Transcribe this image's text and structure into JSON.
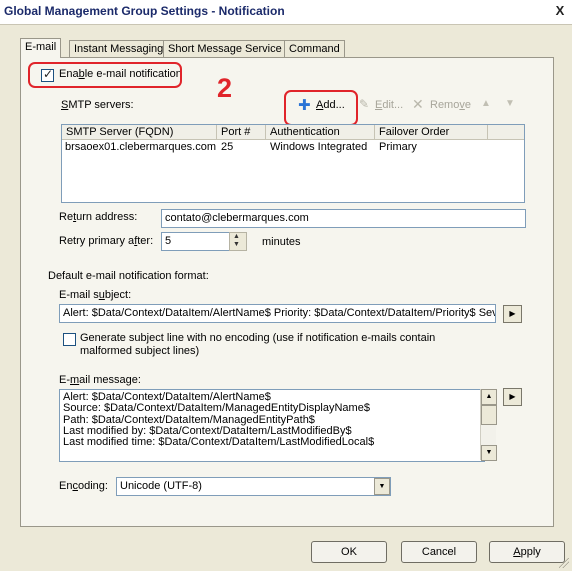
{
  "window": {
    "title": "Global Management Group Settings - Notification",
    "close_glyph": "X"
  },
  "tabs": [
    {
      "label": "E-mail"
    },
    {
      "label": "Instant Messaging"
    },
    {
      "label": "Short Message Service"
    },
    {
      "label": "Command"
    }
  ],
  "enable": {
    "label_pre": "Ena",
    "label_ul": "b",
    "label_post": "le e-mail notification",
    "checked": true,
    "check_glyph": "✓"
  },
  "annotation": {
    "number": "2",
    "color": "#e0242a"
  },
  "smtp": {
    "label_ul": "S",
    "label_rest": "MTP servers:",
    "buttons": {
      "add": {
        "label_ul": "A",
        "label_rest": "dd..."
      },
      "edit": {
        "label_ul": "E",
        "label_rest": "dit..."
      },
      "remove": {
        "label_pre": "Remo",
        "label_ul": "v",
        "label_post": "e"
      }
    },
    "columns": [
      "SMTP Server (FQDN)",
      "Port #",
      "Authentication",
      "Failover Order"
    ],
    "rows": [
      [
        "brsaoex01.clebermarques.com",
        "25",
        "Windows Integrated",
        "Primary"
      ]
    ]
  },
  "return_address": {
    "label_pre": "Re",
    "label_ul": "t",
    "label_post": "urn address:",
    "value": "contato@clebermarques.com"
  },
  "retry": {
    "label_pre": "Retry primary a",
    "label_ul": "f",
    "label_post": "ter:",
    "value": "5",
    "unit": "minutes"
  },
  "format": {
    "heading": "Default e-mail notification format:",
    "subject_label_pre": "E-mail s",
    "subject_label_ul": "u",
    "subject_label_post": "bject:",
    "subject_value": "Alert: $Data/Context/DataItem/AlertName$ Priority: $Data/Context/DataItem/Priority$ Sever",
    "gen_line1": "Generate subject line with no encoding (use if notification e-mails contain",
    "gen_line2": "malformed subject lines)",
    "message_label_pre": "E-",
    "message_label_ul": "m",
    "message_label_post": "ail message:",
    "message_lines": [
      "Alert: $Data/Context/DataItem/AlertName$",
      "Source: $Data/Context/DataItem/ManagedEntityDisplayName$",
      "Path: $Data/Context/DataItem/ManagedEntityPath$",
      "Last modified by: $Data/Context/DataItem/LastModifiedBy$",
      "Last modified time: $Data/Context/DataItem/LastModifiedLocal$"
    ],
    "encoding_label_pre": "En",
    "encoding_label_ul": "c",
    "encoding_label_post": "oding:",
    "encoding_value": "Unicode (UTF-8)"
  },
  "footer": {
    "ok": "OK",
    "cancel": "Cancel",
    "apply_ul": "A",
    "apply_rest": "pply"
  }
}
